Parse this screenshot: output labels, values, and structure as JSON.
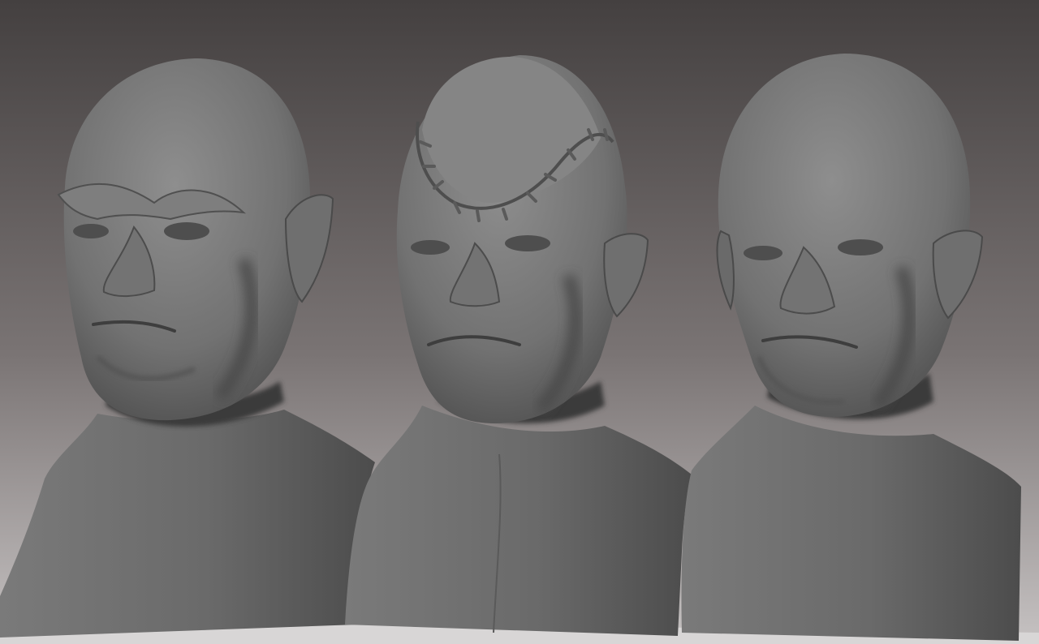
{
  "scene": {
    "description_kind": "render",
    "colors": {
      "background_top": "#444040",
      "background_mid": "#7a7474",
      "background_bottom": "#c6c2c2",
      "clay_light": "#8a8a8a",
      "clay_mid": "#6e6e6e",
      "clay_dark": "#3c3c3c",
      "floor": "#d8d6d6"
    }
  },
  "sculpts": [
    {
      "id": "left-bust",
      "style": "heavy-brow"
    },
    {
      "id": "center-bust",
      "style": "stitched-scalp"
    },
    {
      "id": "right-bust",
      "style": "gaunt"
    }
  ]
}
